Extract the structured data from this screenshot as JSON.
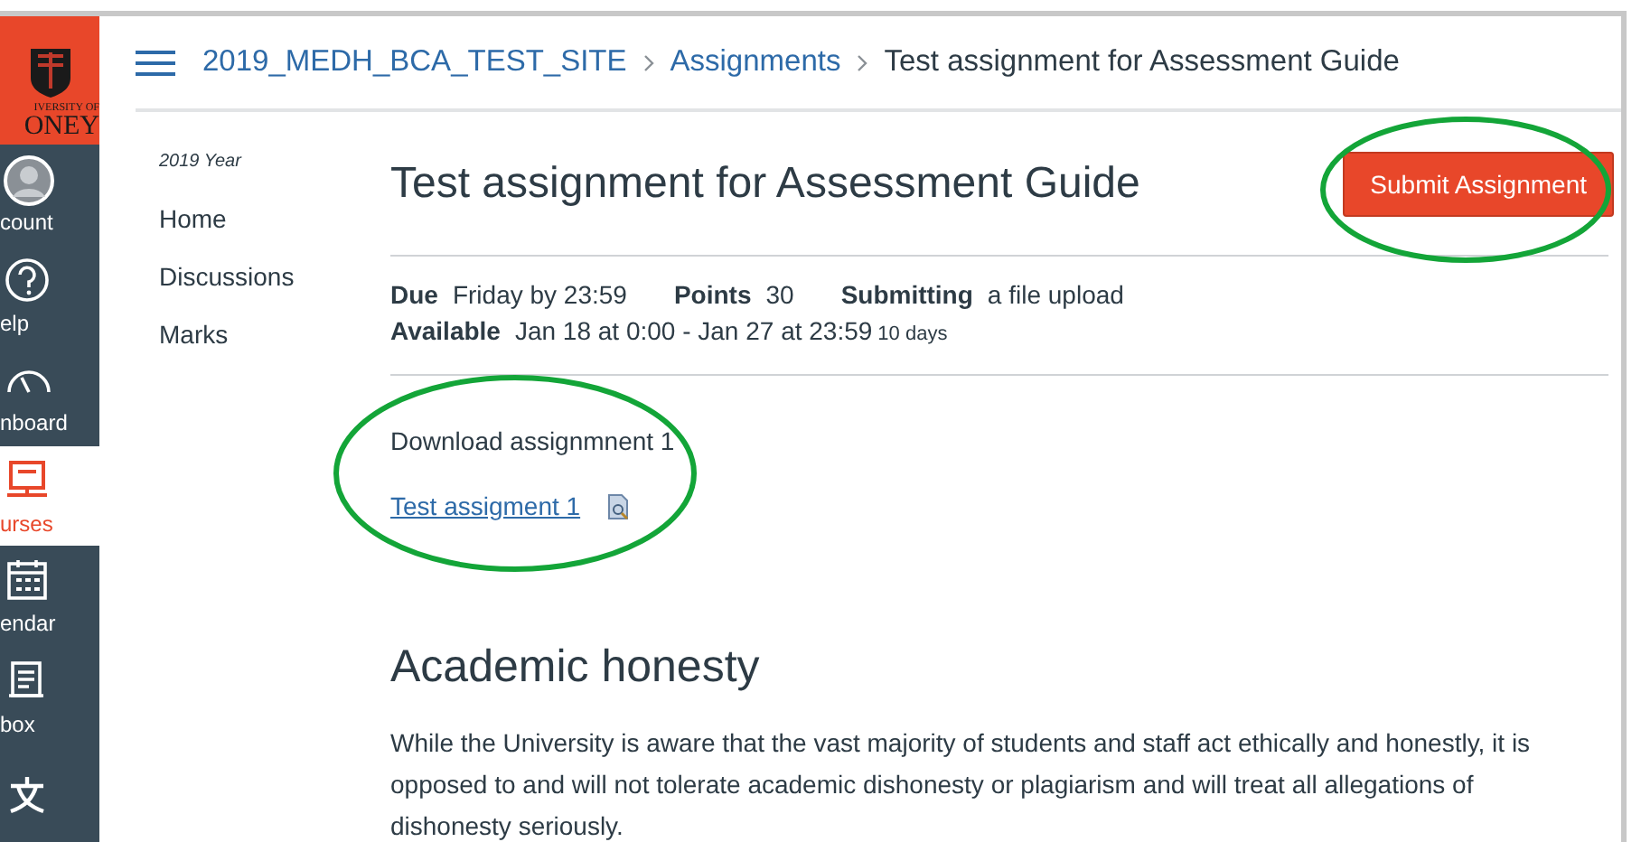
{
  "logo": {
    "line1": "IVERSITY OF",
    "line2": "ONEY"
  },
  "global_nav": [
    {
      "kind": "account",
      "label": "count",
      "selected": false
    },
    {
      "kind": "help",
      "label": "elp",
      "selected": false
    },
    {
      "kind": "dashboard",
      "label": "nboard",
      "selected": false
    },
    {
      "kind": "courses",
      "label": "urses",
      "selected": true
    },
    {
      "kind": "calendar",
      "label": "endar",
      "selected": false
    },
    {
      "kind": "inbox",
      "label": "box",
      "selected": false
    },
    {
      "kind": "translate",
      "selected": false
    }
  ],
  "breadcrumb": [
    "2019_MEDH_BCA_TEST_SITE",
    "Assignments",
    "Test assignment for Assessment Guide"
  ],
  "course_nav": {
    "term": "2019 Year",
    "items": [
      "Home",
      "Discussions",
      "Marks"
    ]
  },
  "assignment": {
    "title": "Test assignment for Assessment Guide",
    "submit_button": {
      "label": "Submit Assignment",
      "highlighted": true
    },
    "details": [
      [
        {
          "label": "Due",
          "value": "Friday by 23:59"
        },
        {
          "label": "Points",
          "value": "30"
        },
        {
          "label": "Submitting",
          "value": "a file upload"
        }
      ],
      [
        {
          "label": "Available",
          "value": "Jan 18 at 0:00 - Jan 27 at 23:59",
          "note": "10 days"
        }
      ]
    ],
    "download": {
      "text": "Download assignmnent 1",
      "link": "Test assigment 1",
      "highlighted": true
    },
    "heading": "Academic honesty",
    "paragraph": "While the University is aware that the vast majority of students and staff act ethically and honestly, it is opposed to and will not tolerate academic dishonesty or plagiarism and will treat all allegations of dishonesty seriously."
  }
}
